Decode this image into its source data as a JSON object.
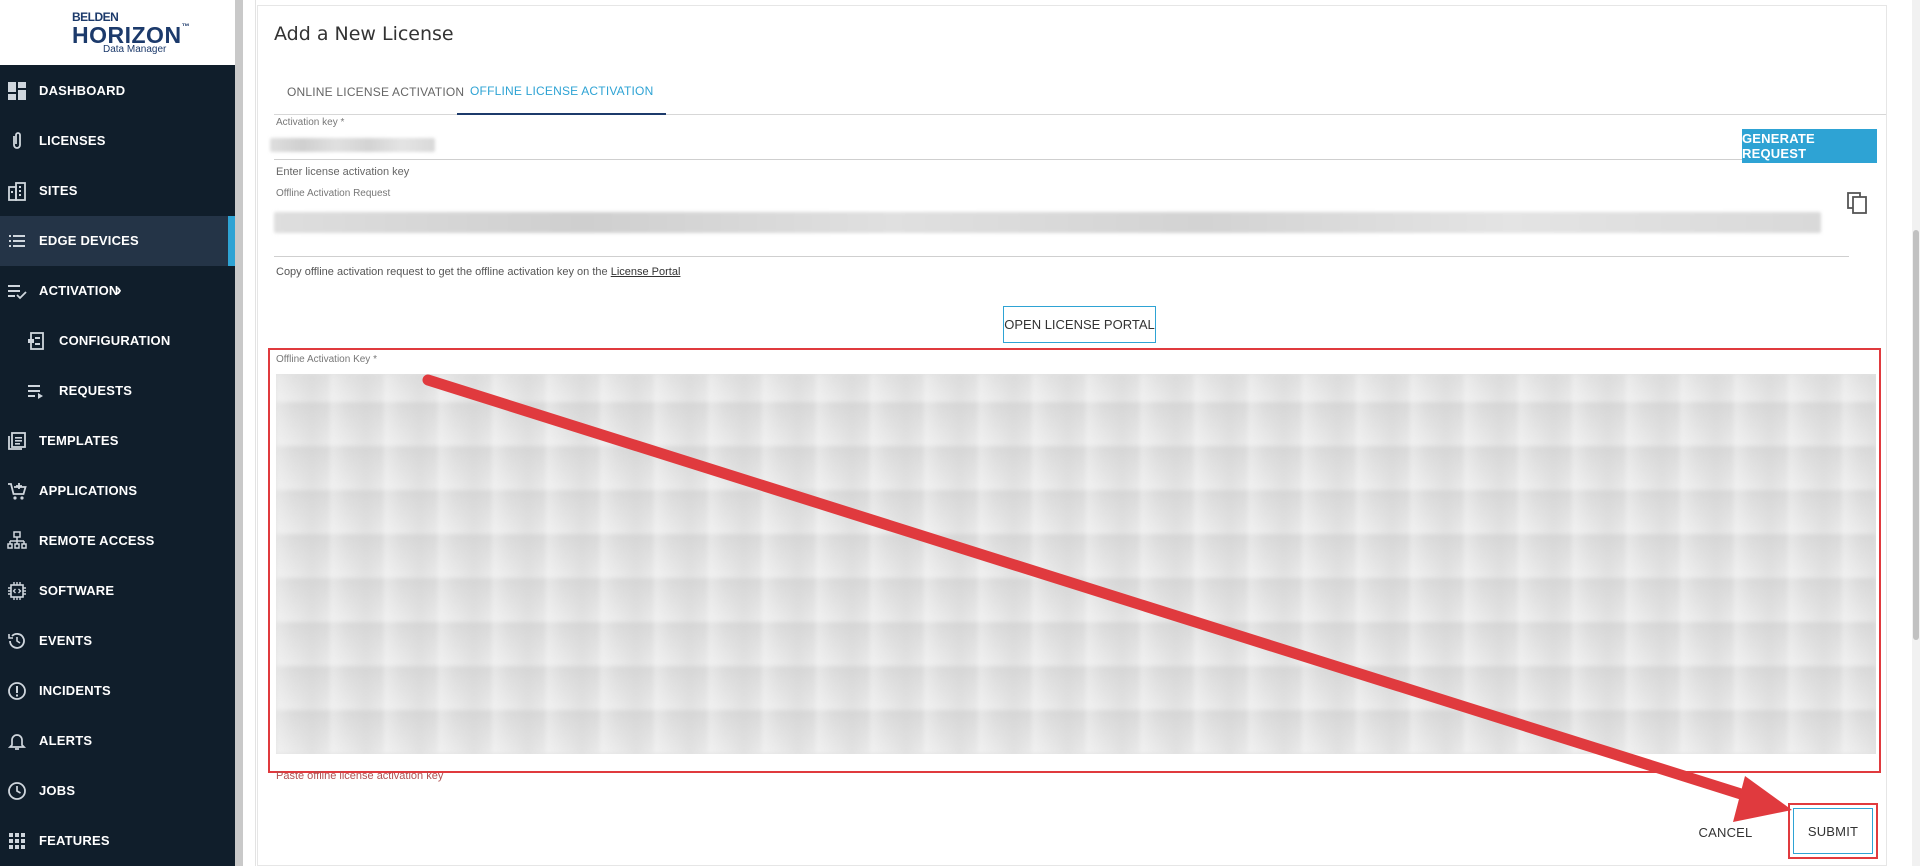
{
  "brand": {
    "line1": "BELDEN",
    "line2": "HORIZON",
    "tm": "™",
    "line3": "Data Manager"
  },
  "sidebar": {
    "items": [
      {
        "label": "DASHBOARD",
        "icon": "dashboard-icon"
      },
      {
        "label": "LICENSES",
        "icon": "paperclip-icon"
      },
      {
        "label": "SITES",
        "icon": "building-icon"
      },
      {
        "label": "EDGE DEVICES",
        "icon": "list-icon",
        "active": true
      },
      {
        "label": "ACTIVATION",
        "icon": "checklist-icon"
      },
      {
        "label": "CONFIGURATION",
        "icon": "config-icon"
      },
      {
        "label": "REQUESTS",
        "icon": "requests-icon"
      },
      {
        "label": "TEMPLATES",
        "icon": "templates-icon"
      },
      {
        "label": "APPLICATIONS",
        "icon": "cart-icon"
      },
      {
        "label": "REMOTE ACCESS",
        "icon": "network-icon"
      },
      {
        "label": "SOFTWARE",
        "icon": "chip-icon"
      },
      {
        "label": "EVENTS",
        "icon": "history-icon"
      },
      {
        "label": "INCIDENTS",
        "icon": "alert-circle-icon"
      },
      {
        "label": "ALERTS",
        "icon": "bell-icon"
      },
      {
        "label": "JOBS",
        "icon": "clock-icon"
      },
      {
        "label": "FEATURES",
        "icon": "grid-icon"
      }
    ]
  },
  "page": {
    "title": "Add a New License"
  },
  "tabs": [
    {
      "label": "ONLINE LICENSE ACTIVATION",
      "active": false
    },
    {
      "label": "OFFLINE LICENSE ACTIVATION",
      "active": true
    }
  ],
  "form": {
    "activation_key_label": "Activation key *",
    "activation_key_hint": "Enter license activation key",
    "generate_button": "GENERATE REQUEST",
    "offline_request_label": "Offline Activation Request",
    "copy_help_prefix": "Copy offline activation request to get the offline activation key on the ",
    "copy_help_link": "License Portal",
    "open_portal_button": "OPEN LICENSE PORTAL",
    "offline_key_label": "Offline Activation Key *",
    "offline_key_hint": "Paste offline license activation key",
    "cancel_button": "CANCEL",
    "submit_button": "SUBMIT"
  },
  "colors": {
    "sidebar_bg": "#101e2b",
    "accent": "#2ea3d4",
    "annotation_red": "#e03a3e"
  }
}
